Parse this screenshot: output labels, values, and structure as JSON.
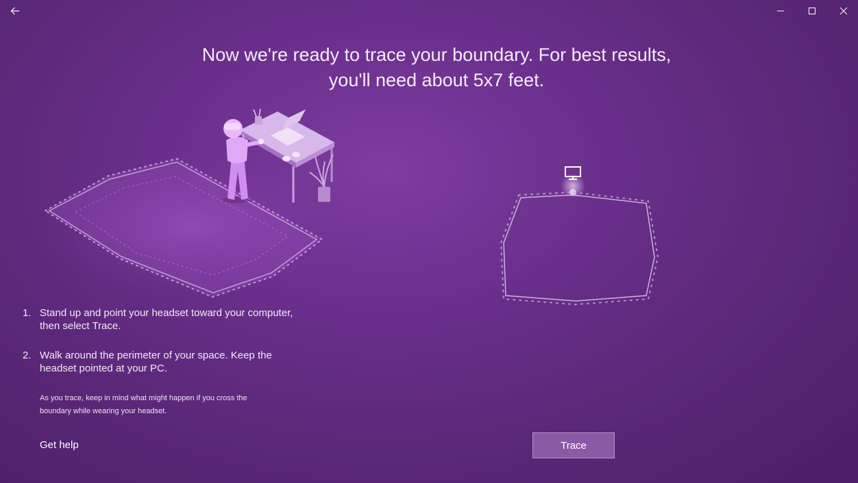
{
  "titlebar": {
    "back_icon": "back-arrow-icon",
    "minimize_icon": "minimize-icon",
    "maximize_icon": "maximize-icon",
    "close_icon": "close-icon"
  },
  "headline": {
    "line1": "Now we're ready to trace your boundary. For best results,",
    "line2": "you'll need about 5x7 feet."
  },
  "illustration": {
    "left_icon": "person-with-headset-at-desk-illustration",
    "right_icon": "pc-monitor-icon",
    "accent_color": "#c9a8de"
  },
  "steps": [
    {
      "number": "1.",
      "text": "Stand up and point your headset toward your computer, then select Trace."
    },
    {
      "number": "2.",
      "text": "Walk around the perimeter of your space. Keep the headset pointed at your PC."
    }
  ],
  "note": "As you trace, keep in mind what might happen if you cross the boundary while wearing your headset.",
  "help_link": "Get help",
  "trace_button": "Trace",
  "colors": {
    "background": "#6a2f8c",
    "button": "#8a5aa5",
    "button_border": "#b892cc"
  }
}
